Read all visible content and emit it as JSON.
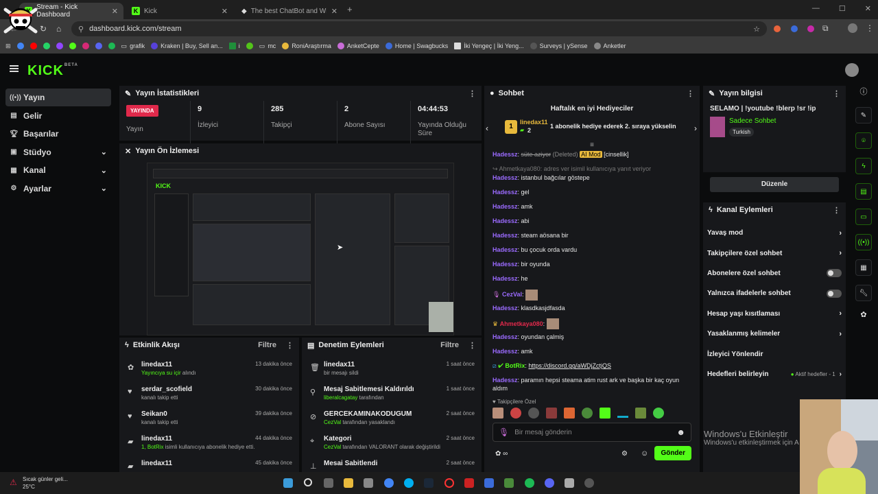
{
  "browser": {
    "tabs": [
      {
        "title": "Stream - Kick Dashboard"
      },
      {
        "title": "Kick"
      },
      {
        "title": "The best ChatBot and Widgets"
      }
    ],
    "url": "dashboard.kick.com/stream"
  },
  "bookmarks": [
    "grafik",
    "Kraken | Buy, Sell an...",
    "i",
    "mc",
    "RoniAraştırma",
    "AnketCepte",
    "Home | Swagbucks",
    "İki Yengeç | İki Yeng...",
    "Surveys | ySense",
    "Anketler"
  ],
  "nav": [
    {
      "label": "Yayın"
    },
    {
      "label": "Gelir"
    },
    {
      "label": "Başarılar"
    },
    {
      "label": "Stüdyo"
    },
    {
      "label": "Kanal"
    },
    {
      "label": "Ayarlar"
    }
  ],
  "stats": {
    "title": "Yayın İstatistikleri",
    "live_badge": "YAYINDA",
    "live_label": "Yayın",
    "items": [
      {
        "value": "9",
        "label": "İzleyici"
      },
      {
        "value": "285",
        "label": "Takipçi"
      },
      {
        "value": "2",
        "label": "Abone Sayısı"
      },
      {
        "value": "04:44:53",
        "label": "Yayında Olduğu Süre"
      }
    ]
  },
  "preview": {
    "title": "Yayın Ön İzlemesi"
  },
  "activity": {
    "title": "Etkinlik Akışı",
    "filter": "Filtre",
    "items": [
      {
        "name": "linedax11",
        "sub_green": "Yayıncıya su içir",
        "sub": " alındı",
        "time": "13 dakika önce"
      },
      {
        "name": "serdar_scofield",
        "sub": "kanalı takip etti",
        "time": "30 dakika önce"
      },
      {
        "name": "Seikan0",
        "sub": "kanalı takip etti",
        "time": "39 dakika önce"
      },
      {
        "name": "linedax11",
        "sub_green": "1, BotRix",
        "sub": " isimli kullanıcıya abonelik hediye etti.",
        "time": "44 dakika önce"
      },
      {
        "name": "linedax11",
        "sub": "",
        "time": "45 dakika önce"
      }
    ]
  },
  "moderation": {
    "title": "Denetim Eylemleri",
    "filter": "Filtre",
    "items": [
      {
        "name": "linedax11",
        "sub": "bir mesajı sildi",
        "time": "1 saat önce"
      },
      {
        "name": "Mesaj Sabitlemesi Kaldırıldı",
        "sub_green": "liberalcagatay",
        "sub": " tarafından",
        "time": "1 saat önce"
      },
      {
        "name": "GERCEKAMINAKODUGUM",
        "sub_green": "CezVal",
        "sub": " tarafından yasaklandı",
        "time": "2 saat önce"
      },
      {
        "name": "Kategori",
        "sub_green": "CezVal",
        "sub": " tarafından VALORANT olarak değiştirildi",
        "time": "2 saat önce"
      },
      {
        "name": "Mesai Sabitlendi",
        "sub": "",
        "time": "2 saat önce"
      }
    ]
  },
  "chat": {
    "title": "Sohbet",
    "gifters_title": "Haftalık en iyi Hediyeciler",
    "gifter_rank": "1",
    "gifter_name": "linedax11",
    "gifter_count": "2",
    "gifter_message": "1 abonelik hediye ederek 2. sıraya yükselin",
    "messages": [
      {
        "user": "Hadessz",
        "text": "süte aziyor",
        "extra": "(Deleted)",
        "tag": "AI Mod",
        "tag2": "[cinsellik]"
      },
      {
        "user": "",
        "text": "Ahmetkaya080: adres ver isimil kullanıcıya yanıt veriyor"
      },
      {
        "user": "Hadessz",
        "text": "istanbul bağcılar göstepe"
      },
      {
        "user": "Hadessz",
        "text": "gel"
      },
      {
        "user": "Hadessz",
        "text": "amk"
      },
      {
        "user": "Hadessz",
        "text": "abi"
      },
      {
        "user": "Hadessz",
        "text": "steam aösana bir"
      },
      {
        "user": "Hadessz",
        "text": "bu çocuk orda vardu"
      },
      {
        "user": "Hadessz",
        "text": "bir oyunda"
      },
      {
        "user": "Hadessz",
        "text": "he"
      },
      {
        "user": "CezVal",
        "text": ""
      },
      {
        "user": "Hadessz",
        "text": "klasdkasjdfasda"
      },
      {
        "user": "Ahmetkaya080",
        "text": ""
      },
      {
        "user": "Hadessz",
        "text": "oyundan çalmiş"
      },
      {
        "user": "Hadessz",
        "text": "amk"
      },
      {
        "user": "BotRix",
        "text": "https://discord.gg/aWDjZctjQS"
      },
      {
        "user": "Hadessz",
        "text": "paramın hepsi steama atim rust ark ve başka bir kaç oyun aldım"
      }
    ],
    "followers_only": "Takipçilere Özel",
    "placeholder": "Bir mesaj gönderin",
    "send": "Gönder"
  },
  "info": {
    "title": "Yayın bilgisi",
    "stream_title": "SELAMO | !youtube !blerp !sr !ip",
    "category": "Sadece Sohbet",
    "language": "Turkish",
    "edit": "Düzenle"
  },
  "actions": {
    "title": "Kanal Eylemleri",
    "items": [
      {
        "label": "Yavaş mod",
        "type": "arrow"
      },
      {
        "label": "Takipçilere özel sohbet",
        "type": "arrow"
      },
      {
        "label": "Abonelere özel sohbet",
        "type": "toggle"
      },
      {
        "label": "Yalnızca ifadelerle sohbet",
        "type": "toggle"
      },
      {
        "label": "Hesap yaşı kısıtlaması",
        "type": "arrow"
      },
      {
        "label": "Yasaklanmış kelimeler",
        "type": "arrow"
      },
      {
        "label": "İzleyici Yönlendir",
        "type": "none"
      },
      {
        "label": "Hedefleri belirleyin",
        "type": "goal",
        "extra": "Aktif hedefler - 1"
      }
    ]
  },
  "windows": {
    "activate": "Windows'u Etkinleştir",
    "activate_sub": "Windows'u etkinleştirmek için A",
    "weather": "Sıcak günler geli...",
    "temp": "25°C"
  },
  "colors": {
    "accent": "#53fc18",
    "live": "#e0294b",
    "username": "#9b6bff"
  }
}
